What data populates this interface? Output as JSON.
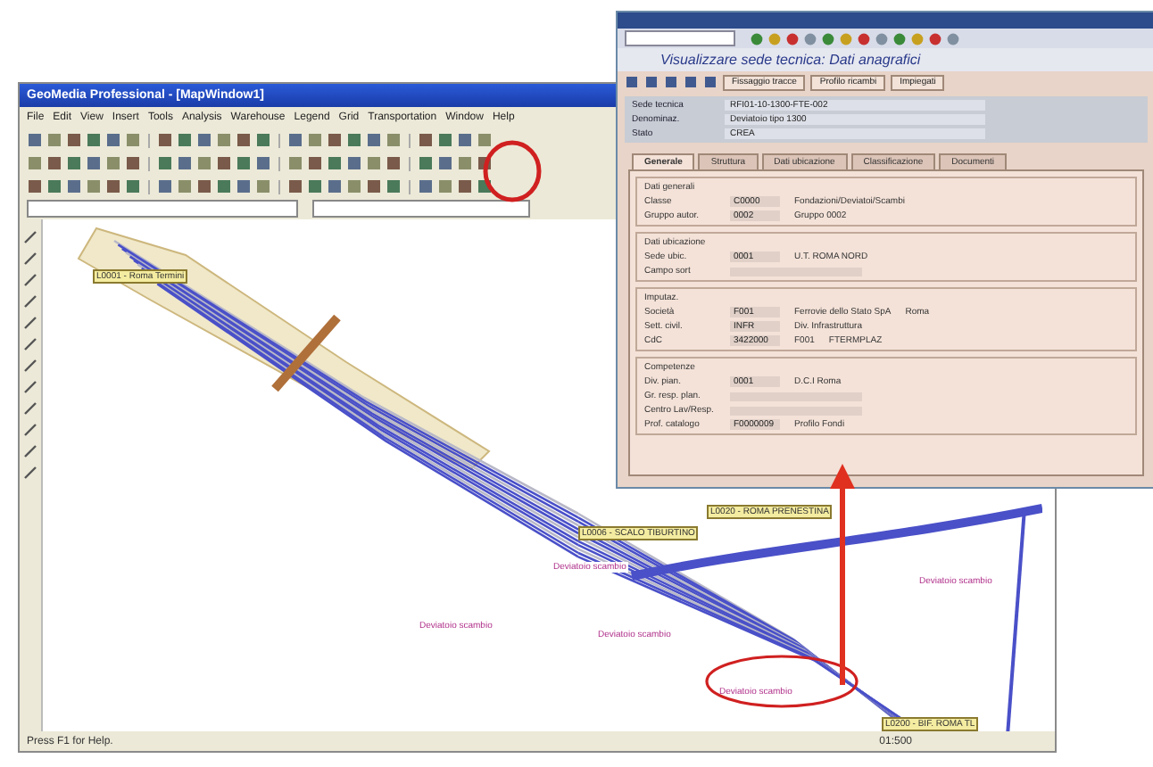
{
  "map_window": {
    "title": "GeoMedia Professional - [MapWindow1]",
    "menu": [
      "File",
      "Edit",
      "View",
      "Insert",
      "Tools",
      "Analysis",
      "Warehouse",
      "Legend",
      "Grid",
      "Transportation",
      "Window",
      "Help"
    ],
    "labels": [
      {
        "text": "L0001 - Roma Termini",
        "kind": "tag"
      },
      {
        "text": "L0020 - ROMA PRENESTINA",
        "kind": "tag"
      },
      {
        "text": "L0006 - SCALO TIBURTINO",
        "kind": "tag"
      },
      {
        "text": "L0200 - BIF. ROMA TL",
        "kind": "tag"
      },
      {
        "text": "Deviatoio scambio",
        "kind": "note"
      },
      {
        "text": "Deviatoio scambio",
        "kind": "note"
      },
      {
        "text": "Deviatoio scambio",
        "kind": "note"
      },
      {
        "text": "Deviatoio scambio",
        "kind": "note"
      },
      {
        "text": "Deviatoio scambio",
        "kind": "note"
      }
    ],
    "status": "Press F1 for Help.",
    "scale": "01:500"
  },
  "sap_window": {
    "title": "Visualizzare sede tecnica: Dati anagrafici",
    "buttons": [
      "Fissaggio tracce",
      "Profilo ricambi",
      "Impiegati"
    ],
    "header_fields": [
      {
        "label": "Sede tecnica",
        "value": "RFI01-10-1300-FTE-002"
      },
      {
        "label": "Denominaz.",
        "value": "Deviatoio tipo 1300"
      },
      {
        "label": "Stato",
        "value": "CREA"
      }
    ],
    "tabs": [
      {
        "label": "Generale",
        "selected": true
      },
      {
        "label": "Struttura",
        "selected": false
      },
      {
        "label": "Dati ubicazione",
        "selected": false
      },
      {
        "label": "Classificazione",
        "selected": false
      },
      {
        "label": "Documenti",
        "selected": false
      }
    ],
    "groups": [
      {
        "title": "Dati generali",
        "rows": [
          {
            "label": "Classe",
            "values": [
              "C0000",
              "Fondazioni/Deviatoi/Scambi"
            ]
          },
          {
            "label": "Gruppo autor.",
            "values": [
              "0002",
              "Gruppo 0002"
            ]
          }
        ]
      },
      {
        "title": "Dati ubicazione",
        "rows": [
          {
            "label": "Sede ubic.",
            "values": [
              "0001",
              "U.T. ROMA NORD"
            ]
          },
          {
            "label": "Campo sort",
            "values": []
          }
        ]
      },
      {
        "title": "Imputaz.",
        "rows": [
          {
            "label": "Società",
            "values": [
              "F001",
              "Ferrovie dello Stato SpA",
              "Roma"
            ]
          },
          {
            "label": "Sett. civil.",
            "values": [
              "INFR",
              "Div. Infrastruttura"
            ]
          },
          {
            "label": "CdC",
            "values": [
              "3422000",
              "F001",
              "FTERMPLAZ"
            ]
          }
        ]
      },
      {
        "title": "Competenze",
        "rows": [
          {
            "label": "Div. pian.",
            "values": [
              "0001",
              "D.C.I Roma"
            ]
          },
          {
            "label": "Gr. resp. plan.",
            "values": []
          },
          {
            "label": "Centro Lav/Resp.",
            "values": []
          },
          {
            "label": "Prof. catalogo",
            "values": [
              "F0000009",
              "Profilo Fondi"
            ]
          }
        ]
      }
    ]
  }
}
